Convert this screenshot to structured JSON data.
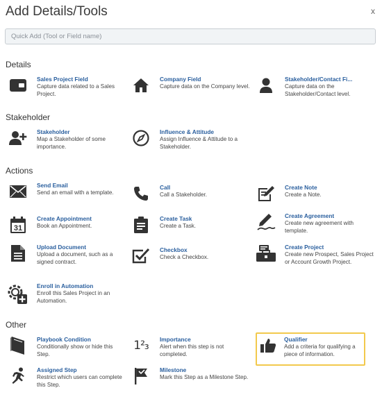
{
  "dialog": {
    "title": "Add Details/Tools",
    "close_label": "x"
  },
  "search": {
    "placeholder": "Quick Add (Tool or Field name)"
  },
  "sections": {
    "details": {
      "title": "Details",
      "items": [
        {
          "name": "Sales Project Field",
          "desc": "Capture data related to a Sales Project.",
          "icon": "field-card-icon"
        },
        {
          "name": "Company Field",
          "desc": "Capture data on the Company level.",
          "icon": "home-icon"
        },
        {
          "name": "Stakeholder/Contact Fi...",
          "desc": "Capture data on the Stakeholder/Contact level.",
          "icon": "person-icon"
        }
      ]
    },
    "stakeholder": {
      "title": "Stakeholder",
      "items": [
        {
          "name": "Stakeholder",
          "desc": "Map a Stakeholder of some importance.",
          "icon": "add-user-icon"
        },
        {
          "name": "Influence & Attitude",
          "desc": "Assign Influence & Attitude to a Stakeholder.",
          "icon": "compass-icon"
        }
      ]
    },
    "actions": {
      "title": "Actions",
      "items": [
        {
          "name": "Send Email",
          "desc": "Send an email with a template.",
          "icon": "envelope-icon"
        },
        {
          "name": "Call",
          "desc": "Call a Stakeholder.",
          "icon": "phone-icon"
        },
        {
          "name": "Create Note",
          "desc": "Create a Note.",
          "icon": "note-edit-icon"
        },
        {
          "name": "Create Appointment",
          "desc": "Book an Appointment.",
          "icon": "calendar-icon",
          "calendar_day": "31"
        },
        {
          "name": "Create Task",
          "desc": "Create a Task.",
          "icon": "clipboard-icon"
        },
        {
          "name": "Create Agreement",
          "desc": "Create new agreement with template.",
          "icon": "signature-icon"
        },
        {
          "name": "Upload Document",
          "desc": "Upload a document, such as a signed contract.",
          "icon": "document-icon"
        },
        {
          "name": "Checkbox",
          "desc": "Check a Checkbox.",
          "icon": "checkbox-icon"
        },
        {
          "name": "Create Project",
          "desc": "Create new Prospect, Sales Project or Account Growth Project.",
          "icon": "briefcase-icon"
        },
        {
          "name": "Enroll in Automation",
          "desc": "Enroll this Sales Project in an Automation.",
          "icon": "automation-gear-icon"
        }
      ]
    },
    "other": {
      "title": "Other",
      "items": [
        {
          "name": "Playbook Condition",
          "desc": "Conditionally show or hide this Step.",
          "icon": "book-icon"
        },
        {
          "name": "Importance",
          "desc": "Alert when this step is not completed.",
          "icon": "numbers-icon",
          "glyph": "1²₃"
        },
        {
          "name": "Qualifier",
          "desc": "Add a criteria for qualifying a piece of information.",
          "icon": "thumbs-up-icon"
        },
        {
          "name": "Assigned Step",
          "desc": "Restrict which users can complete this Step.",
          "icon": "running-person-icon"
        },
        {
          "name": "Milestone",
          "desc": "Mark this Step as a Milestone Step.",
          "icon": "flag-icon"
        }
      ]
    }
  },
  "colors": {
    "link": "#2a5f9e",
    "icon": "#333333",
    "highlight": "#f2c94c"
  }
}
